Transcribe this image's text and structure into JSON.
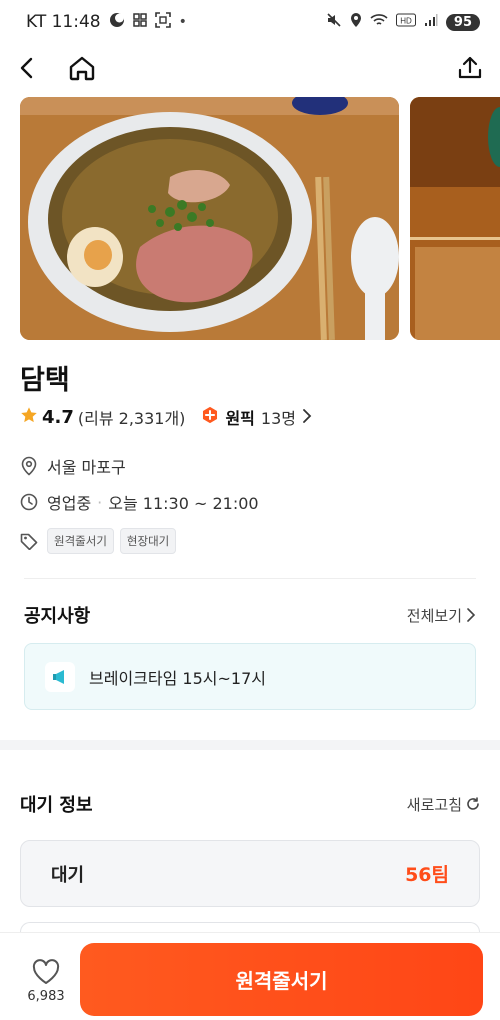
{
  "status_bar": {
    "carrier_time": "KT 11:48",
    "battery": "95",
    "icons": [
      "moon-icon",
      "grid-icon",
      "scan-icon",
      "mute-icon",
      "location-icon",
      "wifi-icon",
      "hd-icon",
      "signal-icon"
    ]
  },
  "nav": {
    "icons": [
      "back-arrow-icon",
      "home-icon",
      "share-icon"
    ]
  },
  "restaurant": {
    "name": "담택",
    "rating": "4.7",
    "review_text": "(리뷰 2,331개)",
    "pick_label": "원픽",
    "pick_count": "13명",
    "location": "서울 마포구",
    "status": "영업중",
    "hours": "오늘 11:30 ~ 21:00",
    "tags": [
      "원격줄서기",
      "현장대기"
    ]
  },
  "notice": {
    "title": "공지사항",
    "view_all": "전체보기",
    "text": "브레이크타임 15시~17시"
  },
  "waiting": {
    "title": "대기 정보",
    "refresh": "새로고침",
    "label": "대기",
    "value": "56팀"
  },
  "bottom": {
    "like_count": "6,983",
    "cta": "원격줄서기"
  },
  "colors": {
    "accent": "#ff4d1a",
    "star": "#f5a623",
    "notice_bg": "#f0fafb"
  }
}
